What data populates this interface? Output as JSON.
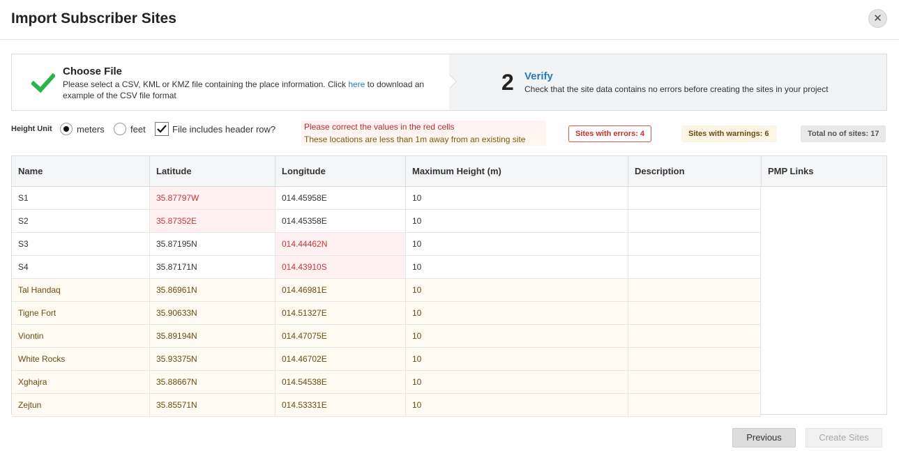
{
  "dialog": {
    "title": "Import Subscriber Sites",
    "close_icon": "close-icon"
  },
  "steps": {
    "step1": {
      "icon": "checkmark-icon",
      "title": "Choose File",
      "desc_before": "Please select a CSV, KML or KMZ file containing the place information. Click ",
      "link_text": "here",
      "desc_after": " to download an example of the CSV file format"
    },
    "step2": {
      "number": "2",
      "title": "Verify",
      "desc": "Check that the site data contains no errors before creating the sites in your project"
    }
  },
  "options": {
    "height_unit_label": "Height Unit",
    "meters_label": "meters",
    "feet_label": "feet",
    "selected_unit": "meters",
    "header_row_label": "File includes header row?",
    "header_row_checked": true
  },
  "messages": {
    "error": "Please correct the values in the red cells",
    "warning": "These locations are less than 1m away from an existing site"
  },
  "badges": {
    "errors": "Sites with errors: 4",
    "warnings": "Sites with warnings: 6",
    "total": "Total no of sites: 17"
  },
  "table": {
    "columns": [
      "Name",
      "Latitude",
      "Longitude",
      "Maximum Height (m)",
      "Description",
      "PMP Links"
    ],
    "rows": [
      {
        "name": "S1",
        "lat": "35.87797W",
        "lon": "014.45958E",
        "height": "10",
        "desc": "",
        "status": "error",
        "error_field": "lat"
      },
      {
        "name": "S2",
        "lat": "35.87352E",
        "lon": "014.45358E",
        "height": "10",
        "desc": "",
        "status": "error",
        "error_field": "lat"
      },
      {
        "name": "S3",
        "lat": "35.87195N",
        "lon": "014.44462N",
        "height": "10",
        "desc": "",
        "status": "error",
        "error_field": "lon"
      },
      {
        "name": "S4",
        "lat": "35.87171N",
        "lon": "014.43910S",
        "height": "10",
        "desc": "",
        "status": "error",
        "error_field": "lon"
      },
      {
        "name": "Tal Handaq",
        "lat": "35.86961N",
        "lon": "014.46981E",
        "height": "10",
        "desc": "",
        "status": "warning",
        "error_field": ""
      },
      {
        "name": "Tigne Fort",
        "lat": "35.90633N",
        "lon": "014.51327E",
        "height": "10",
        "desc": "",
        "status": "warning",
        "error_field": ""
      },
      {
        "name": "Viontin",
        "lat": "35.89194N",
        "lon": "014.47075E",
        "height": "10",
        "desc": "",
        "status": "warning",
        "error_field": ""
      },
      {
        "name": "White Rocks",
        "lat": "35.93375N",
        "lon": "014.46702E",
        "height": "10",
        "desc": "",
        "status": "warning",
        "error_field": ""
      },
      {
        "name": "Xghajra",
        "lat": "35.88667N",
        "lon": "014.54538E",
        "height": "10",
        "desc": "",
        "status": "warning",
        "error_field": ""
      },
      {
        "name": "Zejtun",
        "lat": "35.85571N",
        "lon": "014.53331E",
        "height": "10",
        "desc": "",
        "status": "warning",
        "error_field": ""
      }
    ]
  },
  "buttons": {
    "previous": "Previous",
    "create": "Create Sites"
  },
  "colors": {
    "link": "#2a7ab8",
    "check": "#2db34a",
    "error": "#c9302c",
    "warning_bg": "#fdf5e6"
  }
}
